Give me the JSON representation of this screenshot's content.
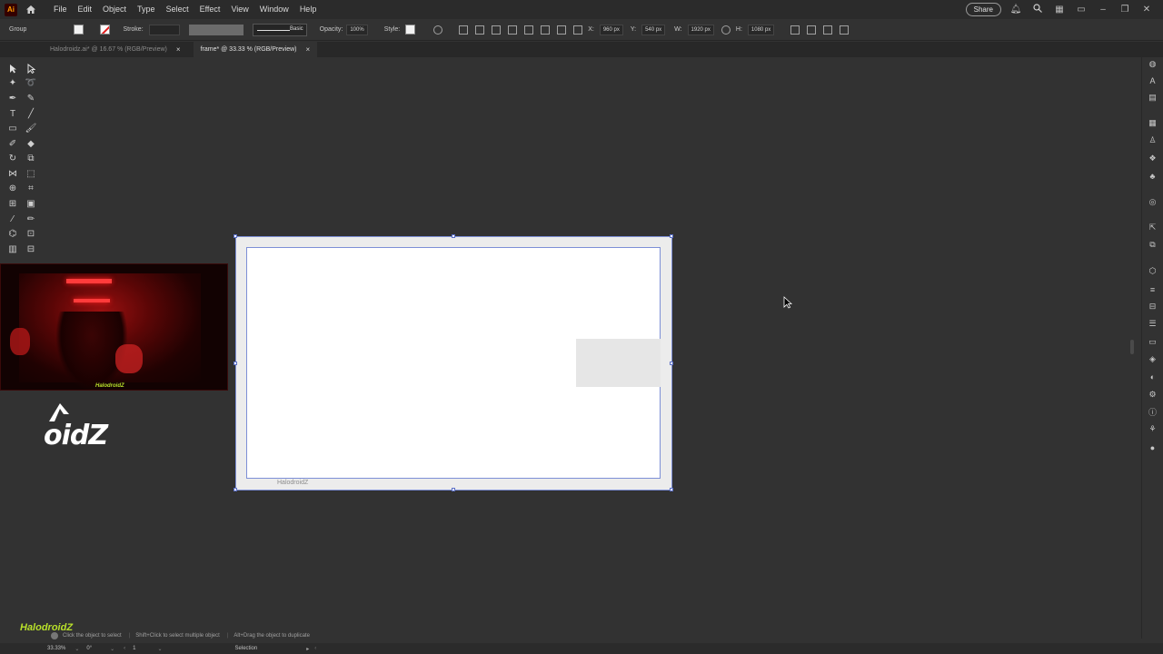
{
  "menubar": {
    "app_logo": "Ai",
    "items": [
      "File",
      "Edit",
      "Object",
      "Type",
      "Select",
      "Effect",
      "View",
      "Window",
      "Help"
    ],
    "share_label": "Share"
  },
  "control_bar": {
    "selection_type": "Group",
    "stroke_label": "Stroke:",
    "brush_label": "Basic",
    "opacity_label": "Opacity:",
    "opacity_value": "100%",
    "style_label": "Style:",
    "x_label": "X:",
    "x_value": "960 px",
    "y_label": "Y:",
    "y_value": "540 px",
    "w_label": "W:",
    "w_value": "1920 px",
    "h_label": "H:",
    "h_value": "1080 px"
  },
  "tabs": [
    {
      "label": "Halodroidz.ai* @ 16.67 % (RGB/Preview)",
      "active": false
    },
    {
      "label": "frame* @ 33.33 % (RGB/Preview)",
      "active": true
    }
  ],
  "canvas": {
    "selection_label": "HalodroidZ"
  },
  "overlay": {
    "webcam_label": "HalodroidZ",
    "logo_text": "oidZ",
    "watermark": "HalodroidZ"
  },
  "hint_bar": {
    "hint1": "Click the object to select",
    "hint2": "Shift+Click to select multiple object",
    "hint3": "Alt+Drag the object to duplicate"
  },
  "status_bar": {
    "zoom": "33.33%",
    "rotation": "0°",
    "artboard_number": "1",
    "tool_name": "Selection"
  },
  "colors": {
    "accent_selection": "#7d8fd6",
    "watermark_green": "#b8e02a",
    "canvas_bg": "#323232"
  }
}
